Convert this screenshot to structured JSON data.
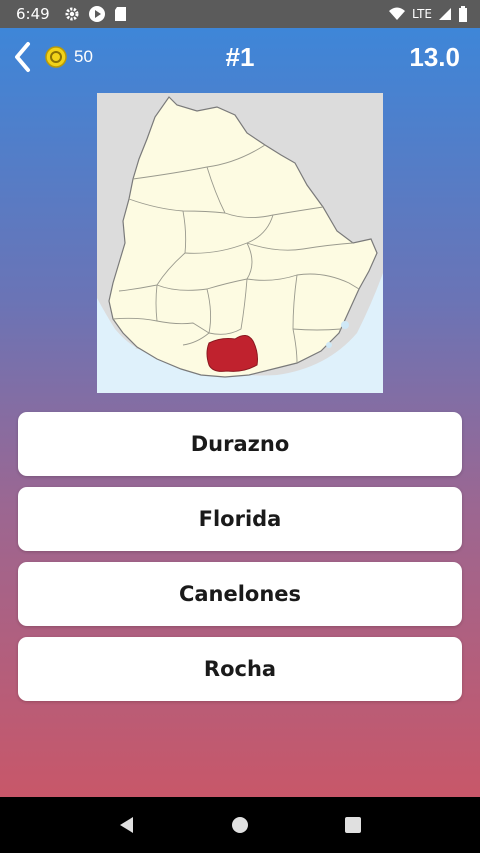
{
  "status_bar": {
    "time": "6:49",
    "network": "LTE",
    "icons": [
      "gear-icon",
      "play-store-icon",
      "sd-card-icon",
      "wifi-icon",
      "signal-icon",
      "battery-icon"
    ]
  },
  "header": {
    "coins": "50",
    "question_number": "#1",
    "timer": "13.0"
  },
  "question": {
    "map_icon": "uruguay-map-highlighted-department",
    "highlight_color": "#c0222e"
  },
  "answers": [
    {
      "label": "Durazno"
    },
    {
      "label": "Florida"
    },
    {
      "label": "Canelones"
    },
    {
      "label": "Rocha"
    }
  ],
  "colors": {
    "gradient_top": "#3e86d8",
    "gradient_bottom": "#c85769",
    "coin": "#f2d319"
  },
  "nav": {
    "icons": [
      "back-triangle-icon",
      "home-circle-icon",
      "recents-square-icon"
    ]
  }
}
